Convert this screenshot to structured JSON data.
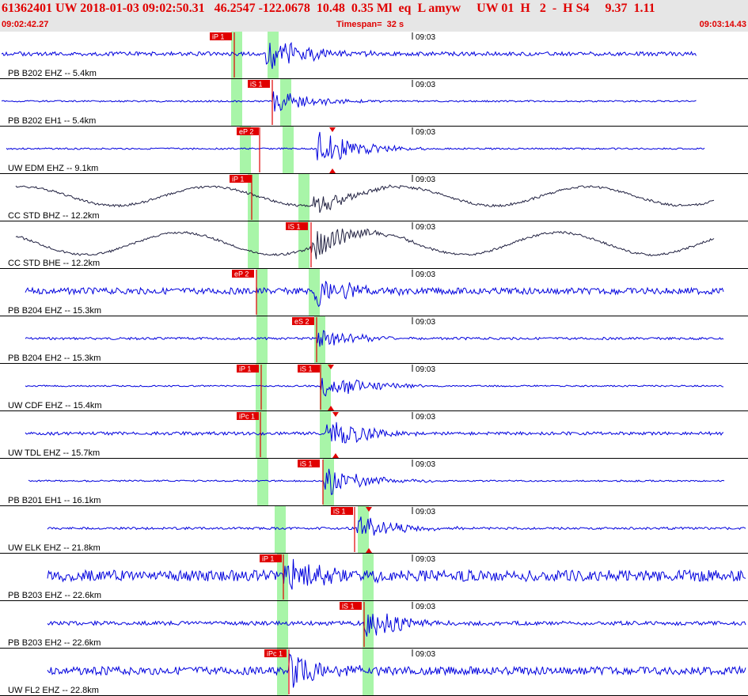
{
  "header": {
    "title": "61362401 UW 2018-01-03 09:02:50.31   46.2547 -122.0678  10.48  0.35 Ml  eq  L amyw     UW 01  H   2  -  H S4     9.37  1.11",
    "start_time": "09:02:42.27",
    "timespan": "Timespan=  32 s",
    "end_time": "09:03:14.43"
  },
  "colors": {
    "trace_blue": "#0000dd",
    "trace_dark": "#202040",
    "pick_red": "#e00000",
    "window_green": "#a8f5a8",
    "header_bg": "#e6e6e6"
  },
  "time_mark_label": "09:03",
  "panels": [
    {
      "label": "PB B202 EHZ -- 5.4km",
      "color": "blue",
      "picks": [
        {
          "label": "iP 1"
        }
      ]
    },
    {
      "label": "PB B202 EH1 -- 5.4km",
      "color": "blue",
      "picks": [
        {
          "label": "iS 1"
        }
      ]
    },
    {
      "label": "UW EDM EHZ -- 9.1km",
      "color": "blue",
      "picks": [
        {
          "label": "eP 2"
        }
      ]
    },
    {
      "label": "CC STD BHZ -- 12.2km",
      "color": "dark",
      "picks": [
        {
          "label": "iP 1"
        }
      ]
    },
    {
      "label": "CC STD BHE -- 12.2km",
      "color": "dark",
      "picks": [
        {
          "label": "iS 1"
        }
      ]
    },
    {
      "label": "PB B204 EHZ -- 15.3km",
      "color": "blue",
      "picks": [
        {
          "label": "eP 2"
        }
      ]
    },
    {
      "label": "PB B204 EH2 -- 15.3km",
      "color": "blue",
      "picks": [
        {
          "label": "eS 2"
        }
      ]
    },
    {
      "label": "UW CDF EHZ -- 15.4km",
      "color": "blue",
      "picks": [
        {
          "label": "iP 1"
        },
        {
          "label": "iS 1"
        }
      ]
    },
    {
      "label": "UW TDL EHZ -- 15.7km",
      "color": "blue",
      "picks": [
        {
          "label": "iPc 1"
        }
      ]
    },
    {
      "label": "PB B201 EH1 -- 16.1km",
      "color": "blue",
      "picks": [
        {
          "label": "iS 1"
        }
      ]
    },
    {
      "label": "UW ELK EHZ -- 21.8km",
      "color": "blue",
      "picks": [
        {
          "label": "iS 1"
        }
      ]
    },
    {
      "label": "PB B203 EHZ -- 22.6km",
      "color": "blue",
      "picks": [
        {
          "label": "iP 1"
        }
      ]
    },
    {
      "label": "PB B203 EH2 -- 22.6km",
      "color": "blue",
      "picks": [
        {
          "label": "iS 1"
        }
      ]
    },
    {
      "label": "UW FL2 EHZ -- 22.8km",
      "color": "blue",
      "picks": [
        {
          "label": "iPc 1"
        }
      ]
    }
  ]
}
